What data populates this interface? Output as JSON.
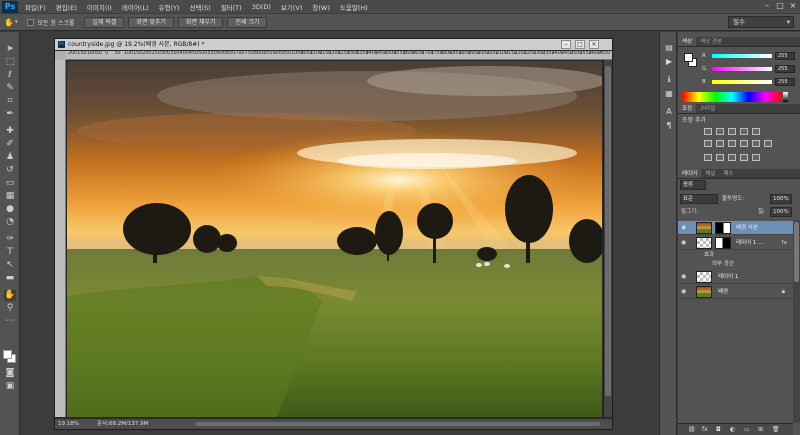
{
  "app": {
    "logo": "Ps"
  },
  "menu": [
    "파일(F)",
    "편집(E)",
    "이미지(I)",
    "레이어(L)",
    "유형(Y)",
    "선택(S)",
    "필터(T)",
    "3D(D)",
    "보기(V)",
    "창(W)",
    "도움말(H)"
  ],
  "window_controls": [
    "–",
    "□",
    "×"
  ],
  "options_bar": {
    "scroll_all_label": "모든 창 스크롤",
    "buttons": [
      "실제 픽셀",
      "화면 맞추기",
      "화면 채우기",
      "인쇄 크기"
    ],
    "workspace": "필수"
  },
  "document": {
    "title": "countryside.jpg @ 19.2%(배경 사본, RGB/8#) *",
    "ps_mini": "Ps",
    "controls": [
      "–",
      "□",
      "×"
    ],
    "zoom": "19.18%",
    "doc_info": "문서:68.2M/137.9M",
    "ruler_ticks": [
      "200",
      "150",
      "100",
      "50",
      "0",
      "50",
      "100",
      "150",
      "200",
      "250",
      "300",
      "350",
      "400",
      "450",
      "500",
      "550",
      "600",
      "650",
      "700",
      "750",
      "800",
      "850",
      "900",
      "950",
      "1000",
      "1050",
      "1100",
      "1150",
      "1200",
      "1250",
      "1300",
      "1350",
      "1400",
      "1450",
      "1500",
      "1550",
      "1600",
      "1650",
      "1700",
      "1750",
      "1800",
      "1850",
      "1900",
      "1950",
      "2000",
      "2050",
      "2100",
      "2150",
      "2200",
      "2250",
      "2300",
      "2350",
      "2400",
      "2450",
      "2500",
      "2550",
      "2600",
      "2650"
    ]
  },
  "color_panel": {
    "tabs": [
      "색상",
      "색상 견본"
    ],
    "rows": [
      {
        "label": "R",
        "value": "255"
      },
      {
        "label": "G",
        "value": "255"
      },
      {
        "label": "B",
        "value": "255"
      }
    ]
  },
  "adjust_panel": {
    "tabs": [
      "조정",
      "스타일"
    ],
    "title": "조정 추가"
  },
  "layers_panel": {
    "tabs": [
      "레이어",
      "채널",
      "패스"
    ],
    "filter_kind": "종류",
    "blend_mode": "표준",
    "opacity_label": "불투명도:",
    "opacity_value": "100%",
    "lock_label": "잠그기:",
    "fill_label": "칠:",
    "fill_value": "100%",
    "layers": [
      {
        "name": "배경 사본",
        "selected": true,
        "has_mask": true
      },
      {
        "name": "레이어 1 ...",
        "selected": false,
        "has_mask": true,
        "fx": "fx"
      },
      {
        "name": "레이어 1",
        "selected": false,
        "has_mask": false
      },
      {
        "name": "배경",
        "selected": false,
        "has_mask": false,
        "locked": true
      }
    ],
    "effects_label": "효과",
    "outer_glow_label": "외부 광선",
    "fx_label": "fx"
  }
}
